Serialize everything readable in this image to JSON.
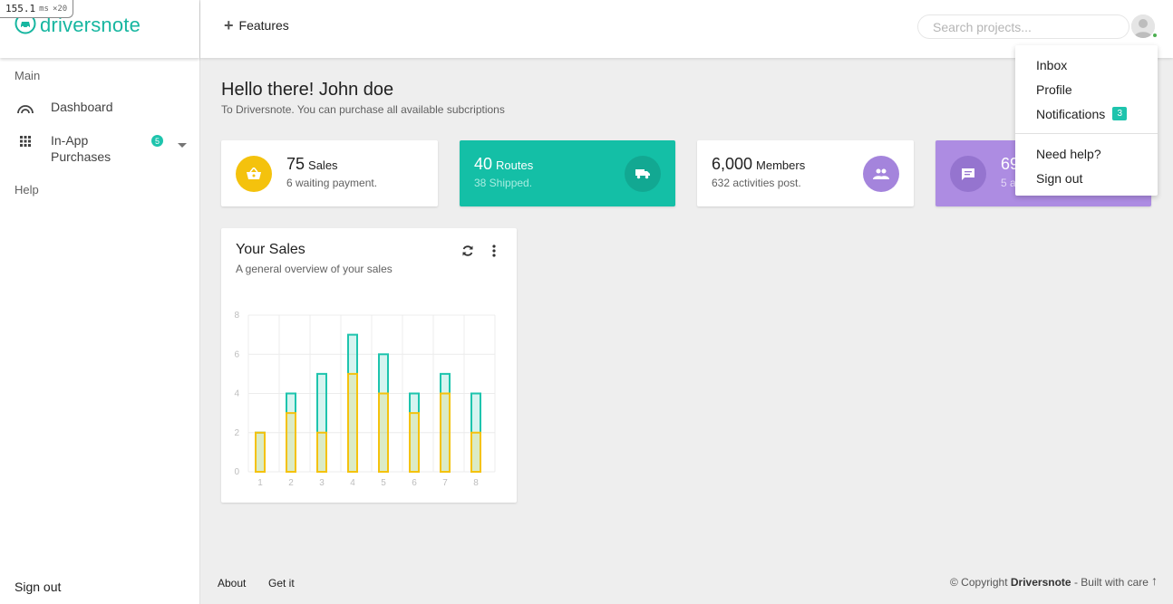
{
  "perf": {
    "value": "155.1",
    "unit": "ms",
    "mult": "×20"
  },
  "brand": {
    "name": "driversnote"
  },
  "sidebar": {
    "section_main": "Main",
    "items": [
      {
        "label": "Dashboard"
      },
      {
        "label": "In-App Purchases",
        "line1": "In-App",
        "line2": "Purchases",
        "badge": "5"
      }
    ],
    "section_help": "Help",
    "signout": "Sign out"
  },
  "topbar": {
    "features_label": "Features",
    "search_placeholder": "Search projects..."
  },
  "dropdown": {
    "items": [
      {
        "label": "Inbox"
      },
      {
        "label": "Profile"
      },
      {
        "label": "Notifications",
        "badge": "3"
      },
      {
        "label": "Need help?"
      },
      {
        "label": "Sign out"
      }
    ]
  },
  "greeting": {
    "title": "Hello there! John doe",
    "subtitle": "To Driversnote. You can purchase all available subcriptions"
  },
  "cards": {
    "sales": {
      "value": "75",
      "label": "Sales",
      "sub": "6 waiting payment."
    },
    "routes": {
      "value": "40",
      "label": "Routes",
      "sub": "38 Shipped."
    },
    "members": {
      "value": "6,000",
      "label": "Members",
      "sub": "632 activities post."
    },
    "messages": {
      "value": "69",
      "sub": "5 a"
    }
  },
  "sales_chart": {
    "title": "Your Sales",
    "subtitle": "A general overview of your sales"
  },
  "chart_data": {
    "type": "bar",
    "categories": [
      "1",
      "2",
      "3",
      "4",
      "5",
      "6",
      "7",
      "8"
    ],
    "series": [
      {
        "values": [
          2,
          4,
          5,
          7,
          6,
          4,
          5,
          4
        ],
        "color": "#1ec4ad"
      },
      {
        "values": [
          2,
          3,
          2,
          5,
          4,
          3,
          4,
          2
        ],
        "color": "#f4c20d"
      }
    ],
    "yticks": [
      0,
      2,
      4,
      6,
      8
    ],
    "ylim": [
      0,
      8
    ],
    "grid": true
  },
  "footer": {
    "about": "About",
    "getit": "Get it",
    "copyright_prefix": "© Copyright",
    "copyright_brand": "Driversnote",
    "copyright_suffix": "- Built with care",
    "up": "↑"
  },
  "colors": {
    "accent": "#14bfa6",
    "yellow": "#f4c20d",
    "purple": "#ad8ce2"
  }
}
